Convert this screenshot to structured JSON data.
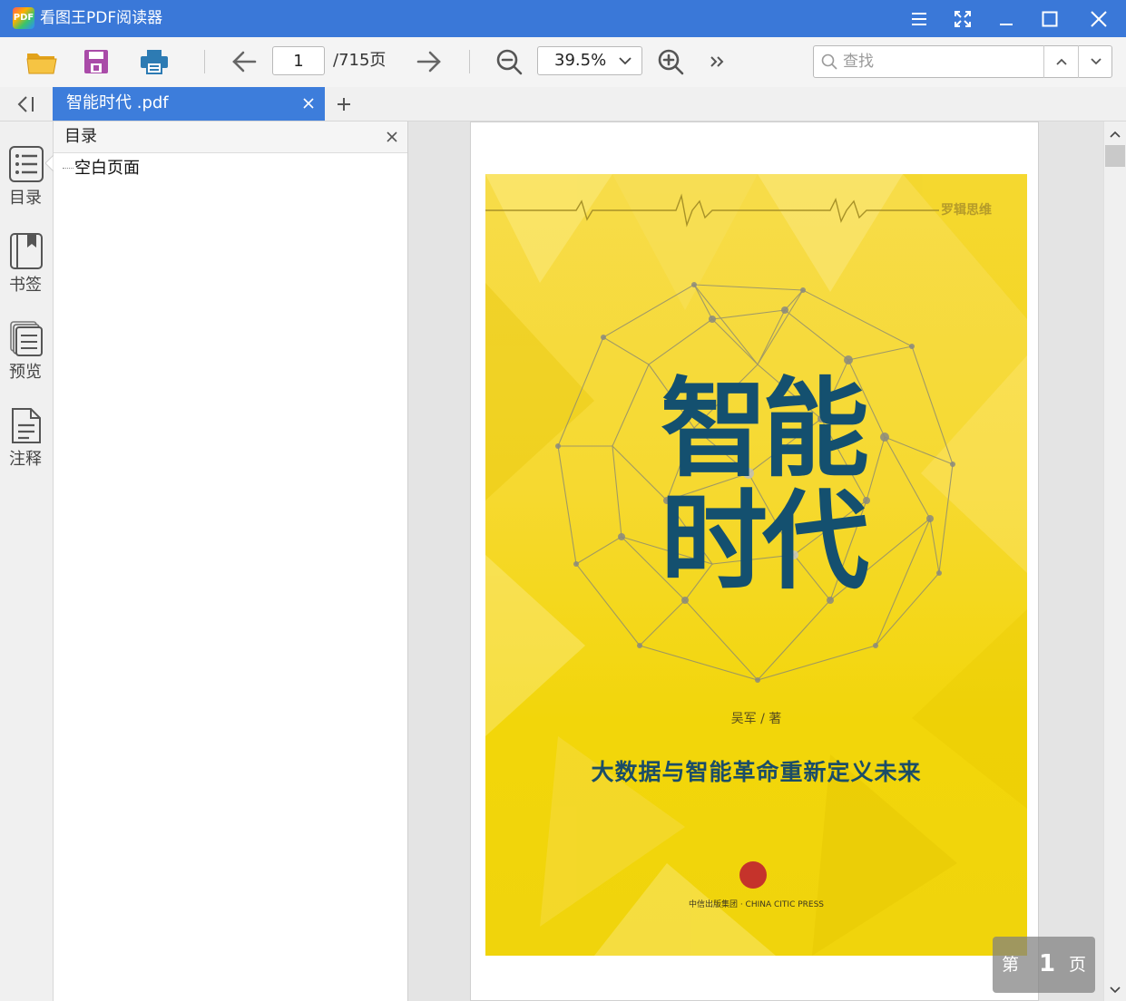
{
  "window": {
    "logo_text": "PDF",
    "title": "看图王PDF阅读器"
  },
  "toolbar": {
    "current_page": "1",
    "total_pages": "/715页",
    "zoom": "39.5%",
    "search_placeholder": "查找"
  },
  "tabs": [
    {
      "label": "智能时代 .pdf",
      "active": true
    }
  ],
  "sidebar": {
    "items": [
      {
        "label": "目录",
        "icon": "list-icon",
        "active": true
      },
      {
        "label": "书签",
        "icon": "bookmark-icon"
      },
      {
        "label": "预览",
        "icon": "thumbnails-icon"
      },
      {
        "label": "注释",
        "icon": "annotation-icon"
      }
    ]
  },
  "outline": {
    "title": "目录",
    "items": [
      {
        "label": "空白页面"
      }
    ]
  },
  "document": {
    "cover": {
      "series": "罗辑思维",
      "title_line1": "智能",
      "title_line2": "时代",
      "author": "吴军 / 著",
      "subtitle": "大数据与智能革命重新定义未来",
      "publisher": "中信出版集团 · CHINA CITIC PRESS"
    }
  },
  "page_indicator": {
    "prefix": "第",
    "number": "1",
    "suffix": "页"
  },
  "colors": {
    "titlebar": "#3a78d8",
    "active_tab": "#3d7ddb",
    "cover_yellow": "#f4d81e",
    "cover_title": "#14506f"
  }
}
